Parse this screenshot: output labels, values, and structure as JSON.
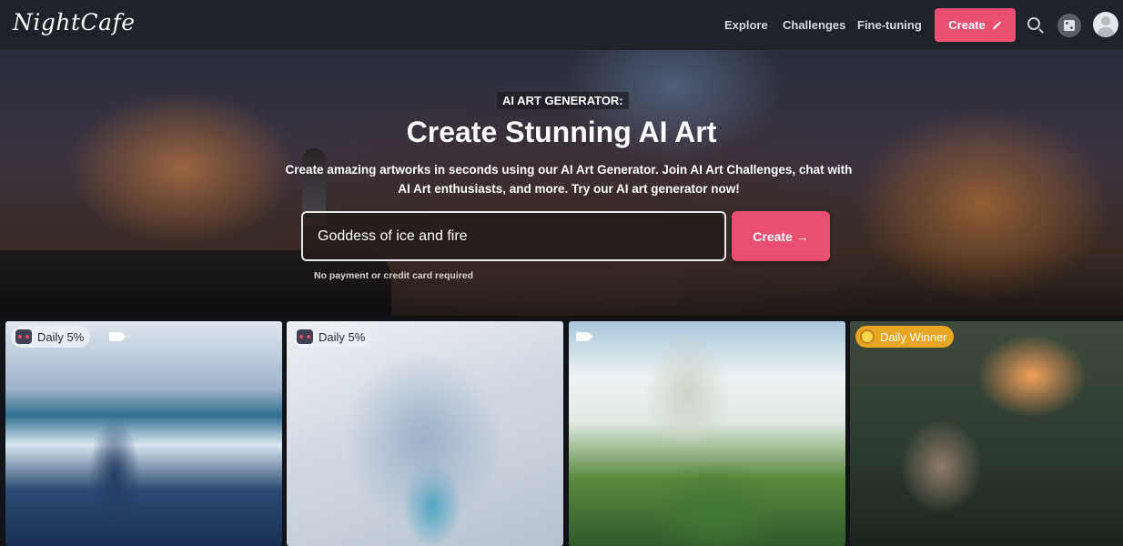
{
  "app": {
    "logo": "NightCafe"
  },
  "nav": {
    "links": [
      "Explore",
      "Challenges",
      "Fine-tuning"
    ],
    "create_label": "Create"
  },
  "hero": {
    "eyebrow": "AI ART GENERATOR:",
    "title": "Create Stunning AI Art",
    "subtitle": "Create amazing artworks in seconds using our AI Art Generator. Join AI Art Challenges, chat with AI Art enthusiasts, and more. Try our AI art generator now!",
    "prompt_value": "Goddess of ice and fire",
    "create_label": "Create →",
    "note": "No payment or credit card required"
  },
  "gallery": {
    "cards": [
      {
        "badge": "Daily 5%",
        "badge_style": "light",
        "video": true
      },
      {
        "badge": "Daily 5%",
        "badge_style": "light",
        "video": false
      },
      {
        "badge": "",
        "badge_style": "none",
        "video": true
      },
      {
        "badge": "Daily Winner",
        "badge_style": "gold",
        "video": false
      }
    ]
  },
  "colors": {
    "accent": "#ea4f72",
    "nav_bg": "#202229",
    "winner_badge": "#e6a621"
  }
}
